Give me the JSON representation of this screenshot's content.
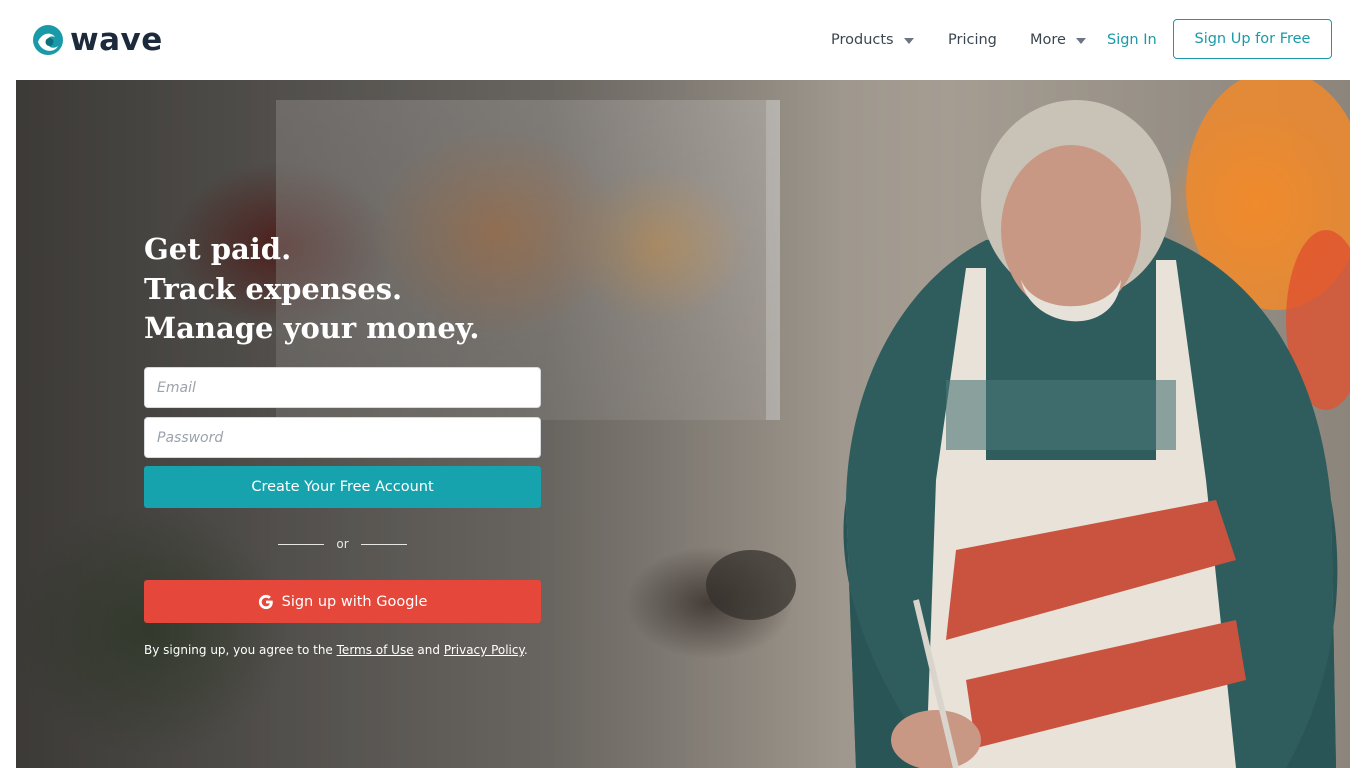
{
  "brand": {
    "name": "wave",
    "accent": "#1a9aa8",
    "google_red": "#e5473b",
    "cta_teal": "#17a3ad"
  },
  "nav": {
    "products": "Products",
    "pricing": "Pricing",
    "more": "More",
    "sign_in": "Sign In",
    "sign_up": "Sign Up for Free"
  },
  "hero": {
    "headline": [
      "Get paid.",
      "Track expenses.",
      "Manage your money."
    ],
    "email_placeholder": "Email",
    "password_placeholder": "Password",
    "create_account": "Create Your Free Account",
    "or": "or",
    "google_signup": "Sign up with Google",
    "terms": {
      "prefix": "By signing up, you agree to the ",
      "terms_link": "Terms of Use",
      "middle": " and ",
      "privacy_link": "Privacy Policy",
      "suffix": "."
    }
  },
  "icons": [
    "wave-logo-icon",
    "chevron-down-icon",
    "google-icon"
  ]
}
